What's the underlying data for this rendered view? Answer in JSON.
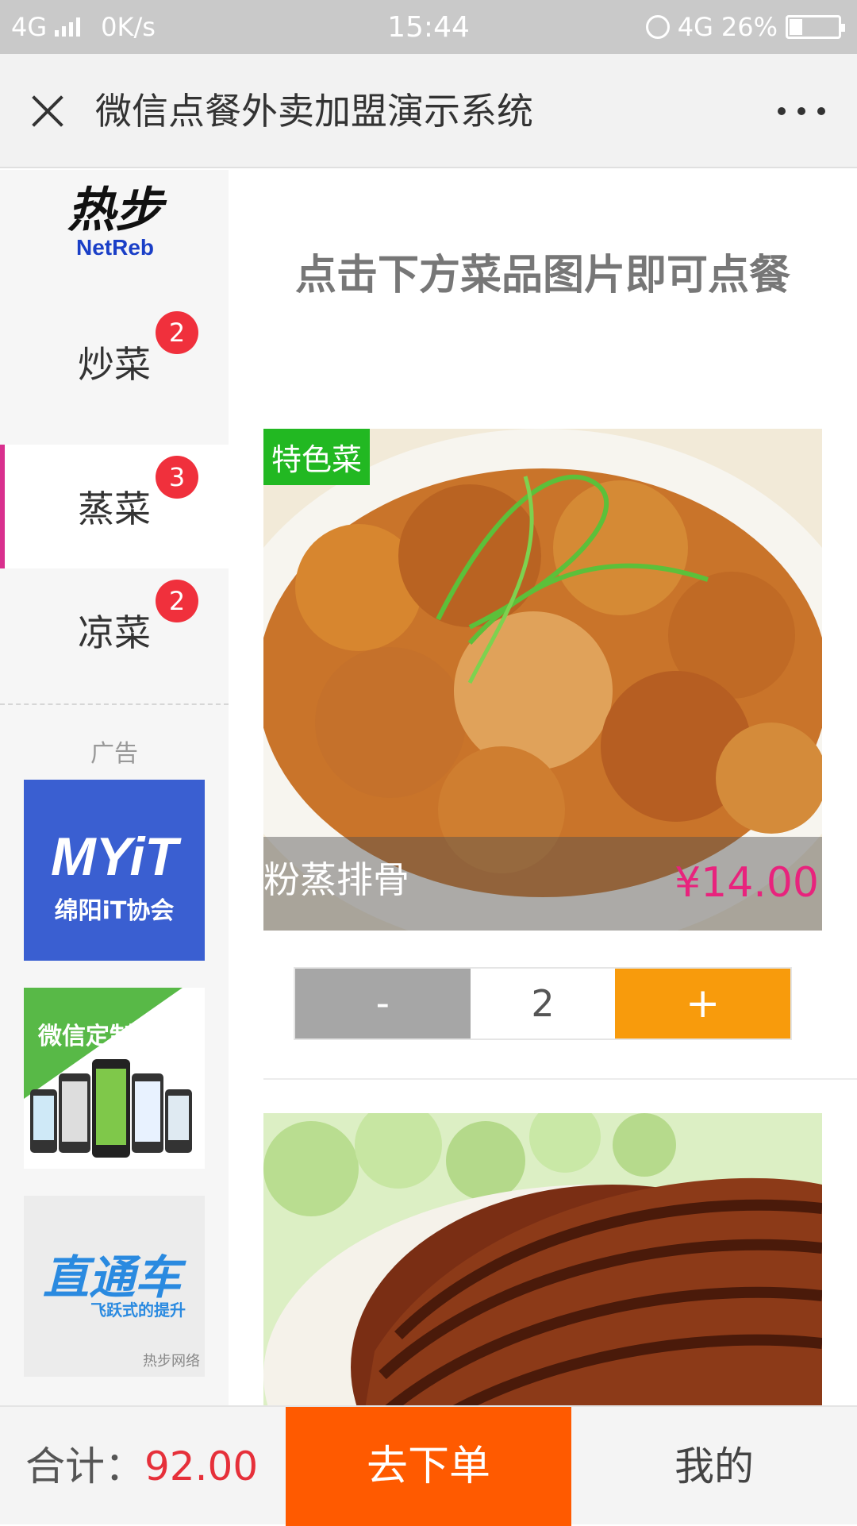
{
  "status_bar": {
    "network_left": "4G",
    "speed": "0K/s",
    "time": "15:44",
    "network_right": "4G",
    "battery": "26%",
    "battery_level": 0.26
  },
  "title_bar": {
    "title": "微信点餐外卖加盟演示系统",
    "close_icon": "close-icon",
    "more_icon": "more-dots-icon"
  },
  "sidebar": {
    "logo": {
      "cn": "热步",
      "en": "NetReb"
    },
    "categories": [
      {
        "label": "炒菜",
        "badge": "2",
        "active": false
      },
      {
        "label": "蒸菜",
        "badge": "3",
        "active": true
      },
      {
        "label": "凉菜",
        "badge": "2",
        "active": false
      }
    ],
    "ads_label": "广告",
    "ads": [
      {
        "title": "MYiT",
        "subtitle": "绵阳iT协会"
      },
      {
        "title": "微信定制开发"
      },
      {
        "title": "直通车",
        "subtitle": "飞跃式的提升",
        "footer": "热步网络"
      }
    ]
  },
  "main": {
    "hint": "点击下方菜品图片即可点餐",
    "dishes": [
      {
        "tag": "特色菜",
        "name": "粉蒸排骨",
        "price": "¥14.00",
        "quantity": "2"
      }
    ],
    "stepper": {
      "minus": "-",
      "plus": "+"
    }
  },
  "bottom_bar": {
    "total_label": "合计：",
    "total_value": "92.00",
    "order_button": "去下单",
    "mine_button": "我的"
  },
  "colors": {
    "accent_orange": "#ff5a00",
    "badge_red": "#f0303c",
    "price_pink": "#e8237d",
    "tag_green": "#22b822",
    "plus_orange": "#f89b0c"
  }
}
